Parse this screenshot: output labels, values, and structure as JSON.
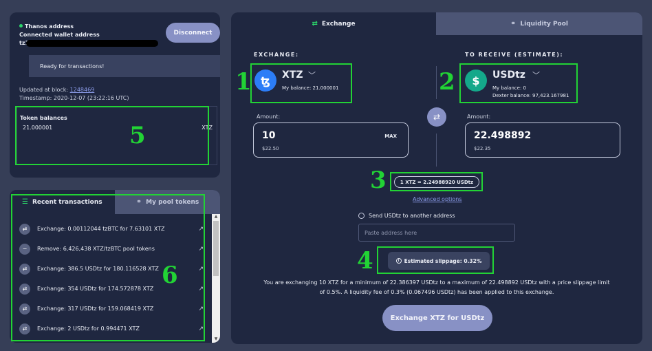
{
  "wallet": {
    "status_label": "Thanos address",
    "connected_label": "Connected wallet address",
    "address_prefix": "tz1",
    "disconnect_label": "Disconnect",
    "ready_text": "Ready for transactions!",
    "updated_label": "Updated at block:",
    "block_number": "1248469",
    "timestamp_text": "Timestamp: 2020-12-07 (23:22:16 UTC)",
    "token_balances_title": "Token balances",
    "token_balance_value": "21.000001",
    "token_balance_unit": "XTZ"
  },
  "transactions": {
    "tab_recent": "Recent transactions",
    "tab_pool": "My pool tokens",
    "items": [
      {
        "text": "Exchange: 0.00112044 tzBTC for 7.63101 XTZ",
        "icon": "swap-icon"
      },
      {
        "text": "Remove: 6,426,438 XTZ/tzBTC pool tokens",
        "icon": "minus-icon"
      },
      {
        "text": "Exchange: 386.5 USDtz for 180.116528 XTZ",
        "icon": "swap-icon"
      },
      {
        "text": "Exchange: 354 USDtz for 174.572878 XTZ",
        "icon": "swap-icon"
      },
      {
        "text": "Exchange: 317 USDtz for 159.068419 XTZ",
        "icon": "swap-icon"
      },
      {
        "text": "Exchange: 2 USDtz for 0.994471 XTZ",
        "icon": "swap-icon"
      }
    ]
  },
  "exchange": {
    "tab_exchange": "Exchange",
    "tab_liquidity": "Liquidity Pool",
    "from_label": "EXCHANGE:",
    "to_label": "TO RECEIVE (ESTIMATE):",
    "from_token": {
      "name": "XTZ",
      "balance": "My balance: 21.000001",
      "icon_glyph": "ꜩ"
    },
    "to_token": {
      "name": "USDtz",
      "balance": "My balance: 0",
      "dexter_balance": "Dexter balance: 97,423.167981",
      "icon_glyph": "$"
    },
    "amount_label": "Amount:",
    "from_amount": "10",
    "from_usd": "$22.50",
    "max_label": "MAX",
    "to_amount": "22.498892",
    "to_usd": "$22.35",
    "rate": "1 XTZ = 2.24988920 USDtz",
    "advanced_label": "Advanced options",
    "send_other_label": "Send USDtz to another address",
    "address_placeholder": "Paste address here",
    "slippage_text": "Estimated slippage: 0.32%",
    "summary_line1": "You are exchanging 10 XTZ for a minimum of 22.386397 USDtz to a maximum of 22.498892 USDtz with a price slippage limit",
    "summary_line2": "of 0.5%. A liquidity fee of 0.3% (0.067496 USDtz) has been applied to this exchange.",
    "submit_label": "Exchange XTZ for USDtz"
  },
  "annotations": [
    "1",
    "2",
    "3",
    "4",
    "5",
    "6"
  ],
  "colors": {
    "background": "#363e57",
    "panel": "#1f2740",
    "accent_button": "#8891c5",
    "highlight": "#22d335",
    "link": "#8b9be8",
    "xtz_icon": "#2c7df7",
    "usdtz_icon": "#14a88a"
  }
}
